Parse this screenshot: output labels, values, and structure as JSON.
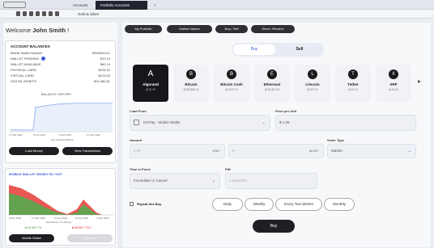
{
  "tabs": [
    {
      "label": "Accounts"
    },
    {
      "label": "Portfolio Accounts"
    },
    {
      "label": "+"
    }
  ],
  "toolbar": {
    "label": "Gold & Silver"
  },
  "sidebar": {
    "welcome_prefix": "Welcome",
    "user_name": "John Smith",
    "welcome_suffix": "!",
    "balances": {
      "title": "ACCOUNT BALANCES",
      "rows": [
        {
          "label": "Mobile Wallet Number",
          "value": "MW0000211"
        },
        {
          "label": "WALLET PENDING",
          "value": "$10.19"
        },
        {
          "label": "WALLET AVAILABLE",
          "value": "$60.19"
        },
        {
          "label": "PHYSICAL CARD",
          "value": "$225.42"
        },
        {
          "label": "VIRTUAL CARD",
          "value": "$123.00"
        },
        {
          "label": "DIGITAL ASSETS",
          "value": "$21,980.81"
        }
      ],
      "history_title": "BALANCE HISTORY",
      "x_axis": [
        "17 Feb 2022",
        "3 Feb 2022",
        "5 Feb 2022",
        "17 Feb 2022"
      ],
      "x_label": "Day Funded Balance",
      "load_label": "Load Money",
      "view_label": "View Transactions"
    },
    "mobile": {
      "title": "MOBILE WALLET MONEY IN / OUT",
      "x_axis": [
        "9 Mar 2022",
        "17 Mar 2022",
        "21 Apr 2022",
        "24 Apr 2022",
        "1 May 2022"
      ],
      "x_label": "Day Money In & Money",
      "legend_in": "MONEY IN",
      "legend_out": "MONEY OUT",
      "wallet_label": "Mobile Wallet",
      "card_label": "Test Card",
      "colors": {
        "in": "#4caf50",
        "out": "#e53935"
      }
    }
  },
  "nav": [
    {
      "label": "My Portfolio"
    },
    {
      "label": "Market Values"
    },
    {
      "label": "Buy / Sell"
    },
    {
      "label": "Send / Receive"
    }
  ],
  "toggle": {
    "buy": "Buy",
    "sell": "Sell"
  },
  "assets": [
    {
      "name": "Algorand",
      "price": "@ $1.05",
      "icon": "algorand-icon",
      "glyph": "A"
    },
    {
      "name": "Bitcoin",
      "price": "@ $26660.23",
      "icon": "bitcoin-icon",
      "glyph": "B"
    },
    {
      "name": "Bitcoin Cash",
      "price": "@ $197.04",
      "icon": "bitcoin-cash-icon",
      "glyph": "B"
    },
    {
      "name": "Ethereum",
      "price": "@ $1,801.03",
      "icon": "ethereum-icon",
      "glyph": "E"
    },
    {
      "name": "Litecoin",
      "price": "@ $70.22",
      "icon": "litecoin-icon",
      "glyph": "L"
    },
    {
      "name": "Tether",
      "price": "@ $1.01",
      "icon": "tether-icon",
      "glyph": "T"
    },
    {
      "name": "XRP",
      "price": "@ $0.43",
      "icon": "xrp-icon",
      "glyph": "X"
    }
  ],
  "form": {
    "load_from_label": "Load From",
    "load_from_value": "DCPay - Mobile Wallet",
    "price_label": "Price per Unit",
    "price_value": "$  1.05",
    "amount_label": "Amount",
    "amount_placeholder": "0.00",
    "amount_currency": "USD",
    "units_placeholder": "0",
    "units_currency": "ALGO",
    "order_type_label": "Order Type",
    "order_type_value": "Market",
    "tif_label": "Time in Force",
    "tif_value": "Immediate or Cancel",
    "pin_label": "PIN",
    "pin_placeholder": "4-Digit PIN",
    "repeat_label": "Repeat this Buy",
    "repeat_options": [
      "Daily",
      "Weekly",
      "Every Two Weeks",
      "Monthly"
    ],
    "submit_label": "Buy"
  }
}
